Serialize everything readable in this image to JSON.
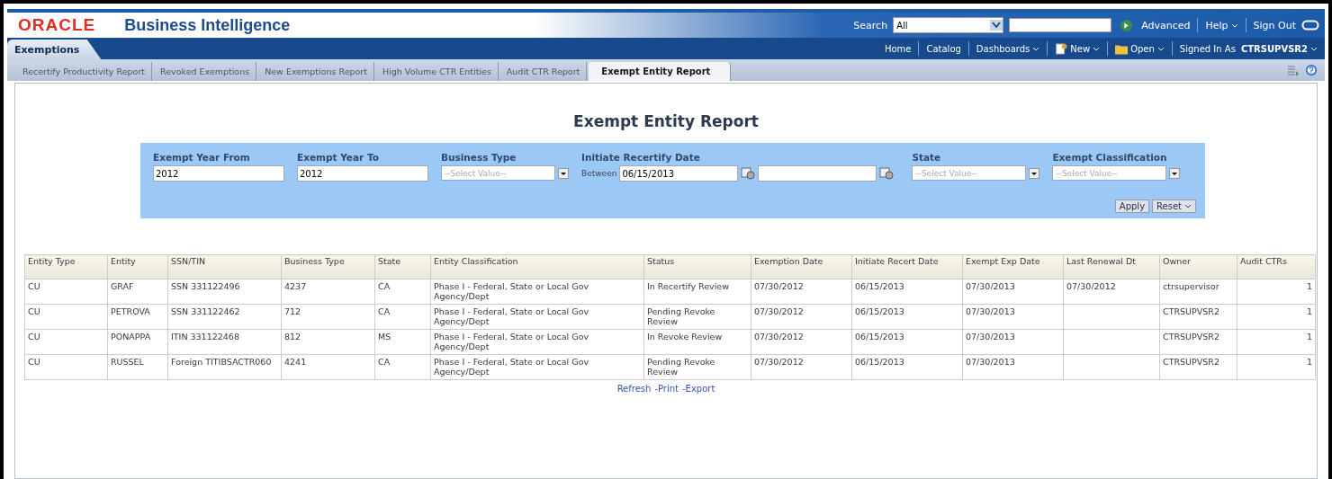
{
  "header": {
    "logo": "ORACLE",
    "product": "Business Intelligence",
    "search_label": "Search",
    "search_scope": "All",
    "advanced": "Advanced",
    "help": "Help",
    "sign_out": "Sign Out"
  },
  "nav": {
    "section": "Exemptions",
    "items": [
      {
        "kind": "plain",
        "label": "Home",
        "menu": false
      },
      {
        "kind": "plain",
        "label": "Catalog",
        "menu": false
      },
      {
        "kind": "plain",
        "label": "Dashboards",
        "menu": true
      },
      {
        "kind": "new",
        "label": "New",
        "menu": true
      },
      {
        "kind": "open",
        "label": "Open",
        "menu": true
      }
    ],
    "signed_in_label": "Signed In As",
    "user": "CTRSUPVSR2"
  },
  "tabs": [
    {
      "label": "Recertify Productivity Report",
      "selected": false
    },
    {
      "label": "Revoked Exemptions",
      "selected": false
    },
    {
      "label": "New Exemptions Report",
      "selected": false
    },
    {
      "label": "High Volume CTR Entities",
      "selected": false
    },
    {
      "label": "Audit CTR Report",
      "selected": false
    },
    {
      "label": "Exempt Entity Report",
      "selected": true
    }
  ],
  "report_title": "Exempt Entity Report",
  "filters": [
    {
      "kind": "text",
      "label": "Exempt Year From",
      "value": "2012"
    },
    {
      "kind": "text",
      "label": "Exempt Year To",
      "value": "2012"
    },
    {
      "kind": "select",
      "label": "Business Type",
      "placeholder": "--Select Value--"
    },
    {
      "kind": "date_range",
      "label": "Initiate Recertify Date",
      "prefix": "Between",
      "value": "06/15/2013"
    },
    {
      "kind": "select",
      "label": "State",
      "placeholder": "--Select Value--"
    },
    {
      "kind": "select",
      "label": "Exempt Classification",
      "placeholder": "--Select Value--"
    }
  ],
  "buttons": {
    "apply": "Apply",
    "reset": "Reset"
  },
  "table": {
    "columns": [
      "Entity Type",
      "Entity",
      "SSN/TIN",
      "Business Type",
      "State",
      "Entity Classification",
      "Status",
      "Exemption Date",
      "Initiate Recert Date",
      "Exempt Exp Date",
      "Last Renewal Dt",
      "Owner",
      "Audit CTRs"
    ],
    "rows": [
      [
        "CU",
        "GRAF",
        "SSN 331122496",
        "4237",
        "CA",
        "Phase I - Federal, State or Local Gov Agency/Dept",
        "In Recertify Review",
        "07/30/2012",
        "06/15/2013",
        "07/30/2013",
        "07/30/2012",
        "ctrsupervisor",
        "1"
      ],
      [
        "CU",
        "PETROVA",
        "SSN 331122462",
        "712",
        "CA",
        "Phase I - Federal, State or Local Gov Agency/Dept",
        "Pending Revoke Review",
        "07/30/2012",
        "06/15/2013",
        "07/30/2013",
        null,
        "CTRSUPVSR2",
        "1"
      ],
      [
        "CU",
        "PONAPPA",
        "ITIN 331122468",
        "812",
        "MS",
        "Phase I - Federal, State or Local Gov Agency/Dept",
        "In Revoke Review",
        "07/30/2012",
        "06/15/2013",
        "07/30/2013",
        null,
        "CTRSUPVSR2",
        "1"
      ],
      [
        "CU",
        "RUSSEL",
        "Foreign TITIBSACTR060",
        "4241",
        "CA",
        "Phase I - Federal, State or Local Gov Agency/Dept",
        "Pending Revoke Review",
        "07/30/2012",
        "06/15/2013",
        "07/30/2013",
        null,
        "CTRSUPVSR2",
        "1"
      ]
    ]
  },
  "footer_links": [
    "Refresh",
    "-Print",
    "-Export"
  ]
}
